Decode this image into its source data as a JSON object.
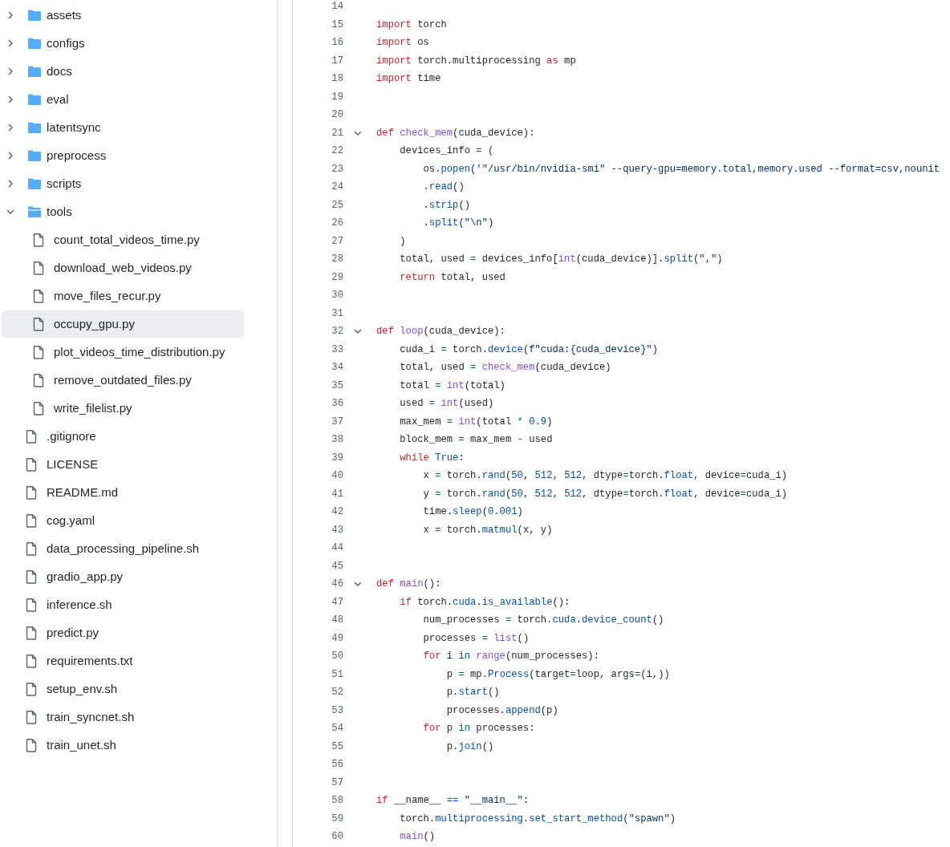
{
  "file_tree": [
    {
      "name": "assets",
      "kind": "folder",
      "expanded": false,
      "selected": false
    },
    {
      "name": "configs",
      "kind": "folder",
      "expanded": false,
      "selected": false
    },
    {
      "name": "docs",
      "kind": "folder",
      "expanded": false,
      "selected": false
    },
    {
      "name": "eval",
      "kind": "folder",
      "expanded": false,
      "selected": false
    },
    {
      "name": "latentsync",
      "kind": "folder",
      "expanded": false,
      "selected": false
    },
    {
      "name": "preprocess",
      "kind": "folder",
      "expanded": false,
      "selected": false
    },
    {
      "name": "scripts",
      "kind": "folder",
      "expanded": false,
      "selected": false
    },
    {
      "name": "tools",
      "kind": "folder",
      "expanded": true,
      "selected": false,
      "children": [
        {
          "name": "count_total_videos_time.py",
          "kind": "file",
          "selected": false
        },
        {
          "name": "download_web_videos.py",
          "kind": "file",
          "selected": false
        },
        {
          "name": "move_files_recur.py",
          "kind": "file",
          "selected": false
        },
        {
          "name": "occupy_gpu.py",
          "kind": "file",
          "selected": true
        },
        {
          "name": "plot_videos_time_distribution.py",
          "kind": "file",
          "selected": false
        },
        {
          "name": "remove_outdated_files.py",
          "kind": "file",
          "selected": false
        },
        {
          "name": "write_filelist.py",
          "kind": "file",
          "selected": false
        }
      ]
    },
    {
      "name": ".gitignore",
      "kind": "file",
      "selected": false
    },
    {
      "name": "LICENSE",
      "kind": "file",
      "selected": false
    },
    {
      "name": "README.md",
      "kind": "file",
      "selected": false
    },
    {
      "name": "cog.yaml",
      "kind": "file",
      "selected": false
    },
    {
      "name": "data_processing_pipeline.sh",
      "kind": "file",
      "selected": false
    },
    {
      "name": "gradio_app.py",
      "kind": "file",
      "selected": false
    },
    {
      "name": "inference.sh",
      "kind": "file",
      "selected": false
    },
    {
      "name": "predict.py",
      "kind": "file",
      "selected": false
    },
    {
      "name": "requirements.txt",
      "kind": "file",
      "selected": false
    },
    {
      "name": "setup_env.sh",
      "kind": "file",
      "selected": false
    },
    {
      "name": "train_syncnet.sh",
      "kind": "file",
      "selected": false
    },
    {
      "name": "train_unet.sh",
      "kind": "file",
      "selected": false
    }
  ],
  "code_lines": [
    {
      "number": "14",
      "foldable": false
    },
    {
      "number": "15",
      "foldable": false,
      "tokens": [
        {
          "keyword": "import"
        },
        {
          "plain": " torch"
        }
      ]
    },
    {
      "number": "16",
      "foldable": false,
      "tokens": [
        {
          "keyword": "import"
        },
        {
          "plain": " os"
        }
      ]
    },
    {
      "number": "17",
      "foldable": false,
      "tokens": [
        {
          "keyword": "import"
        },
        {
          "plain": " torch.multiprocessing "
        },
        {
          "keyword": "as"
        },
        {
          "plain": " mp"
        }
      ]
    },
    {
      "number": "18",
      "foldable": false,
      "tokens": [
        {
          "keyword": "import"
        },
        {
          "plain": " time"
        }
      ]
    },
    {
      "number": "19",
      "foldable": false
    },
    {
      "number": "20",
      "foldable": false
    },
    {
      "number": "21",
      "foldable": true,
      "tokens": [
        {
          "keyword": "def "
        },
        {
          "function": "check_mem"
        },
        {
          "plain": "(cuda_device):"
        }
      ]
    },
    {
      "number": "22",
      "foldable": false,
      "tokens": [
        {
          "plain": "    devices_info "
        },
        {
          "attr": "="
        },
        {
          "plain": " ("
        }
      ]
    },
    {
      "number": "23",
      "foldable": false,
      "tokens": [
        {
          "plain": "        os."
        },
        {
          "attr": "popen"
        },
        {
          "plain": "("
        },
        {
          "string": "'\"/usr/bin/nvidia-smi\" --query-gpu=memory.total,memory.used --format=csv,nounit"
        }
      ]
    },
    {
      "number": "24",
      "foldable": false,
      "tokens": [
        {
          "plain": "        ."
        },
        {
          "attr": "read"
        },
        {
          "plain": "()"
        }
      ]
    },
    {
      "number": "25",
      "foldable": false,
      "tokens": [
        {
          "plain": "        ."
        },
        {
          "attr": "strip"
        },
        {
          "plain": "()"
        }
      ]
    },
    {
      "number": "26",
      "foldable": false,
      "tokens": [
        {
          "plain": "        ."
        },
        {
          "attr": "split"
        },
        {
          "plain": "("
        },
        {
          "string": "\"\\n\""
        },
        {
          "plain": ")"
        }
      ]
    },
    {
      "number": "27",
      "foldable": false,
      "tokens": [
        {
          "plain": "    )"
        }
      ]
    },
    {
      "number": "28",
      "foldable": false,
      "tokens": [
        {
          "plain": "    total, used "
        },
        {
          "attr": "="
        },
        {
          "plain": " devices_info["
        },
        {
          "function": "int"
        },
        {
          "plain": "(cuda_device)]."
        },
        {
          "attr": "split"
        },
        {
          "plain": "("
        },
        {
          "string": "\",\""
        },
        {
          "plain": ")"
        }
      ]
    },
    {
      "number": "29",
      "foldable": false,
      "tokens": [
        {
          "keyword": "    return"
        },
        {
          "plain": " total, used"
        }
      ]
    },
    {
      "number": "30",
      "foldable": false
    },
    {
      "number": "31",
      "foldable": false
    },
    {
      "number": "32",
      "foldable": true,
      "tokens": [
        {
          "keyword": "def "
        },
        {
          "function": "loop"
        },
        {
          "plain": "(cuda_device):"
        }
      ]
    },
    {
      "number": "33",
      "foldable": false,
      "tokens": [
        {
          "plain": "    cuda_i "
        },
        {
          "attr": "="
        },
        {
          "plain": " torch."
        },
        {
          "attr": "device"
        },
        {
          "plain": "("
        },
        {
          "string": "f\"cuda:{cuda_device}\""
        },
        {
          "plain": ")"
        }
      ]
    },
    {
      "number": "34",
      "foldable": false,
      "tokens": [
        {
          "plain": "    total, used "
        },
        {
          "attr": "= "
        },
        {
          "function": "check_mem"
        },
        {
          "plain": "(cuda_device)"
        }
      ]
    },
    {
      "number": "35",
      "foldable": false,
      "tokens": [
        {
          "plain": "    total "
        },
        {
          "attr": "= "
        },
        {
          "function": "int"
        },
        {
          "plain": "(total)"
        }
      ]
    },
    {
      "number": "36",
      "foldable": false,
      "tokens": [
        {
          "plain": "    used "
        },
        {
          "attr": "= "
        },
        {
          "function": "int"
        },
        {
          "plain": "(used)"
        }
      ]
    },
    {
      "number": "37",
      "foldable": false,
      "tokens": [
        {
          "plain": "    max_mem "
        },
        {
          "attr": "= "
        },
        {
          "function": "int"
        },
        {
          "plain": "(total "
        },
        {
          "attr": "* 0.9"
        },
        {
          "plain": ")"
        }
      ]
    },
    {
      "number": "38",
      "foldable": false,
      "tokens": [
        {
          "plain": "    block_mem "
        },
        {
          "attr": "="
        },
        {
          "plain": " max_mem "
        },
        {
          "attr": "-"
        },
        {
          "plain": " used"
        }
      ]
    },
    {
      "number": "39",
      "foldable": false,
      "tokens": [
        {
          "keyword": "    while "
        },
        {
          "attr": "True"
        },
        {
          "plain": ":"
        }
      ]
    },
    {
      "number": "40",
      "foldable": false,
      "tokens": [
        {
          "plain": "        x "
        },
        {
          "attr": "="
        },
        {
          "plain": " torch."
        },
        {
          "attr": "rand"
        },
        {
          "plain": "("
        },
        {
          "attr": "50"
        },
        {
          "plain": ", "
        },
        {
          "attr": "512"
        },
        {
          "plain": ", "
        },
        {
          "attr": "512"
        },
        {
          "plain": ", dtype"
        },
        {
          "attr": "="
        },
        {
          "plain": "torch."
        },
        {
          "attr": "float"
        },
        {
          "plain": ", device"
        },
        {
          "attr": "="
        },
        {
          "plain": "cuda_i)"
        }
      ]
    },
    {
      "number": "41",
      "foldable": false,
      "tokens": [
        {
          "plain": "        y "
        },
        {
          "attr": "="
        },
        {
          "plain": " torch."
        },
        {
          "attr": "rand"
        },
        {
          "plain": "("
        },
        {
          "attr": "50"
        },
        {
          "plain": ", "
        },
        {
          "attr": "512"
        },
        {
          "plain": ", "
        },
        {
          "attr": "512"
        },
        {
          "plain": ", dtype"
        },
        {
          "attr": "="
        },
        {
          "plain": "torch."
        },
        {
          "attr": "float"
        },
        {
          "plain": ", device"
        },
        {
          "attr": "="
        },
        {
          "plain": "cuda_i)"
        }
      ]
    },
    {
      "number": "42",
      "foldable": false,
      "tokens": [
        {
          "plain": "        time."
        },
        {
          "attr": "sleep"
        },
        {
          "plain": "("
        },
        {
          "attr": "0.001"
        },
        {
          "plain": ")"
        }
      ]
    },
    {
      "number": "43",
      "foldable": false,
      "tokens": [
        {
          "plain": "        x "
        },
        {
          "attr": "="
        },
        {
          "plain": " torch."
        },
        {
          "attr": "matmul"
        },
        {
          "plain": "(x, y)"
        }
      ]
    },
    {
      "number": "44",
      "foldable": false
    },
    {
      "number": "45",
      "foldable": false
    },
    {
      "number": "46",
      "foldable": true,
      "tokens": [
        {
          "keyword": "def "
        },
        {
          "function": "main"
        },
        {
          "plain": "():"
        }
      ]
    },
    {
      "number": "47",
      "foldable": false,
      "tokens": [
        {
          "keyword": "    if"
        },
        {
          "plain": " torch."
        },
        {
          "attr": "cuda"
        },
        {
          "plain": "."
        },
        {
          "attr": "is_available"
        },
        {
          "plain": "():"
        }
      ]
    },
    {
      "number": "48",
      "foldable": false,
      "tokens": [
        {
          "plain": "        num_processes "
        },
        {
          "attr": "="
        },
        {
          "plain": " torch."
        },
        {
          "attr": "cuda"
        },
        {
          "plain": "."
        },
        {
          "attr": "device_count"
        },
        {
          "plain": "()"
        }
      ]
    },
    {
      "number": "49",
      "foldable": false,
      "tokens": [
        {
          "plain": "        processes "
        },
        {
          "attr": "= "
        },
        {
          "function": "list"
        },
        {
          "plain": "()"
        }
      ]
    },
    {
      "number": "50",
      "foldable": false,
      "tokens": [
        {
          "keyword": "        for"
        },
        {
          "plain": " i "
        },
        {
          "attr": "in "
        },
        {
          "function": "range"
        },
        {
          "plain": "(num_processes):"
        }
      ]
    },
    {
      "number": "51",
      "foldable": false,
      "tokens": [
        {
          "plain": "            p "
        },
        {
          "attr": "="
        },
        {
          "plain": " mp."
        },
        {
          "attr": "Process"
        },
        {
          "plain": "(target"
        },
        {
          "attr": "="
        },
        {
          "plain": "loop, args"
        },
        {
          "attr": "="
        },
        {
          "plain": "(i,))"
        }
      ]
    },
    {
      "number": "52",
      "foldable": false,
      "tokens": [
        {
          "plain": "            p."
        },
        {
          "attr": "start"
        },
        {
          "plain": "()"
        }
      ]
    },
    {
      "number": "53",
      "foldable": false,
      "tokens": [
        {
          "plain": "            processes."
        },
        {
          "attr": "append"
        },
        {
          "plain": "(p)"
        }
      ]
    },
    {
      "number": "54",
      "foldable": false,
      "tokens": [
        {
          "keyword": "        for"
        },
        {
          "plain": " p "
        },
        {
          "attr": "in"
        },
        {
          "plain": " processes:"
        }
      ]
    },
    {
      "number": "55",
      "foldable": false,
      "tokens": [
        {
          "plain": "            p."
        },
        {
          "attr": "join"
        },
        {
          "plain": "()"
        }
      ]
    },
    {
      "number": "56",
      "foldable": false
    },
    {
      "number": "57",
      "foldable": false
    },
    {
      "number": "58",
      "foldable": false,
      "tokens": [
        {
          "keyword": "if"
        },
        {
          "plain": " __name__ "
        },
        {
          "attr": "== "
        },
        {
          "string": "\"__main__\""
        },
        {
          "plain": ":"
        }
      ]
    },
    {
      "number": "59",
      "foldable": false,
      "tokens": [
        {
          "plain": "    torch."
        },
        {
          "attr": "multiprocessing"
        },
        {
          "plain": "."
        },
        {
          "attr": "set_start_method"
        },
        {
          "plain": "("
        },
        {
          "string": "\"spawn\""
        },
        {
          "plain": ")"
        }
      ]
    },
    {
      "number": "60",
      "foldable": false,
      "tokens": [
        {
          "function": "    main"
        },
        {
          "plain": "()"
        }
      ]
    }
  ]
}
